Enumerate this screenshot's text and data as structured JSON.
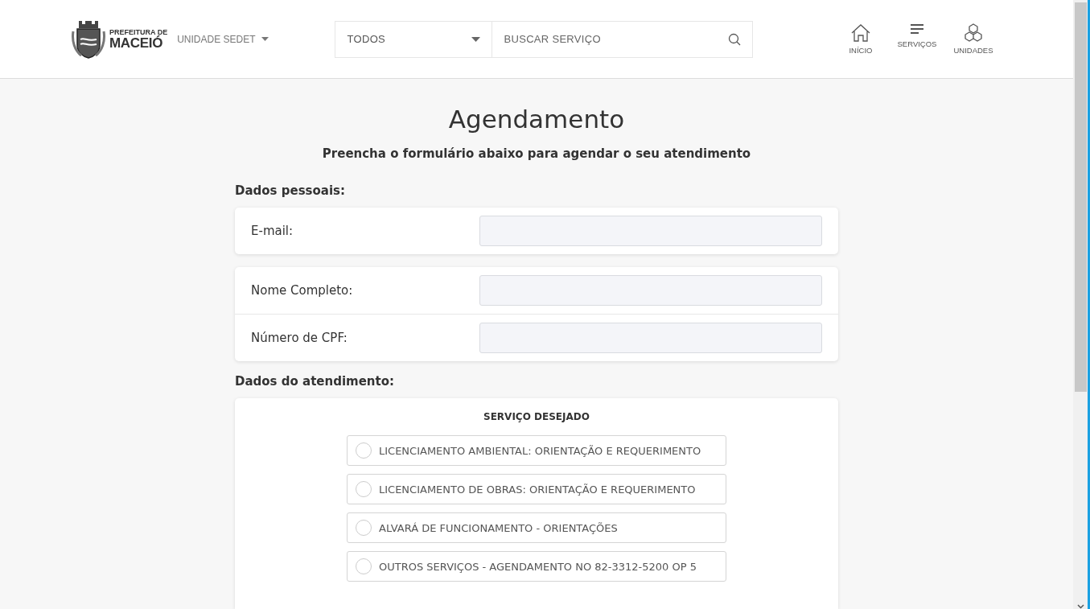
{
  "header": {
    "logo": {
      "line_1": "PREFEITURA DE",
      "line_2": "MACEIÓ"
    },
    "unit_menu": "UNIDADE SEDET",
    "category_select": "TODOS",
    "search": {
      "placeholder": "BUSCAR SERVIÇO"
    },
    "nav": [
      {
        "kind": "home",
        "label": "INÍCIO"
      },
      {
        "kind": "list",
        "label": "SERVIÇOS"
      },
      {
        "kind": "boxes",
        "label": "UNIDADES"
      }
    ]
  },
  "title": "Agendamento",
  "subtitle": "Preencha o formulário abaixo para agendar o seu atendimento",
  "personal": {
    "heading": "Dados pessoais:",
    "groups": [
      [
        {
          "label": "E-mail:"
        }
      ],
      [
        {
          "label": "Nome Completo:"
        },
        {
          "label": "Número de CPF:"
        }
      ]
    ]
  },
  "service": {
    "heading": "Dados do atendimento:",
    "question": "SERVIÇO DESEJADO",
    "options": [
      {
        "label": "LICENCIAMENTO AMBIENTAL: ORIENTAÇÃO E REQUERIMENTO",
        "selected": false
      },
      {
        "label": "LICENCIAMENTO DE OBRAS: ORIENTAÇÃO E REQUERIMENTO",
        "selected": false
      },
      {
        "label": "ALVARÁ DE FUNCIONAMENTO - ORIENTAÇÕES",
        "selected": false
      },
      {
        "label": "OUTROS SERVIÇOS - AGENDAMENTO NO 82-3312-5200 OP 5",
        "selected": false
      }
    ]
  }
}
